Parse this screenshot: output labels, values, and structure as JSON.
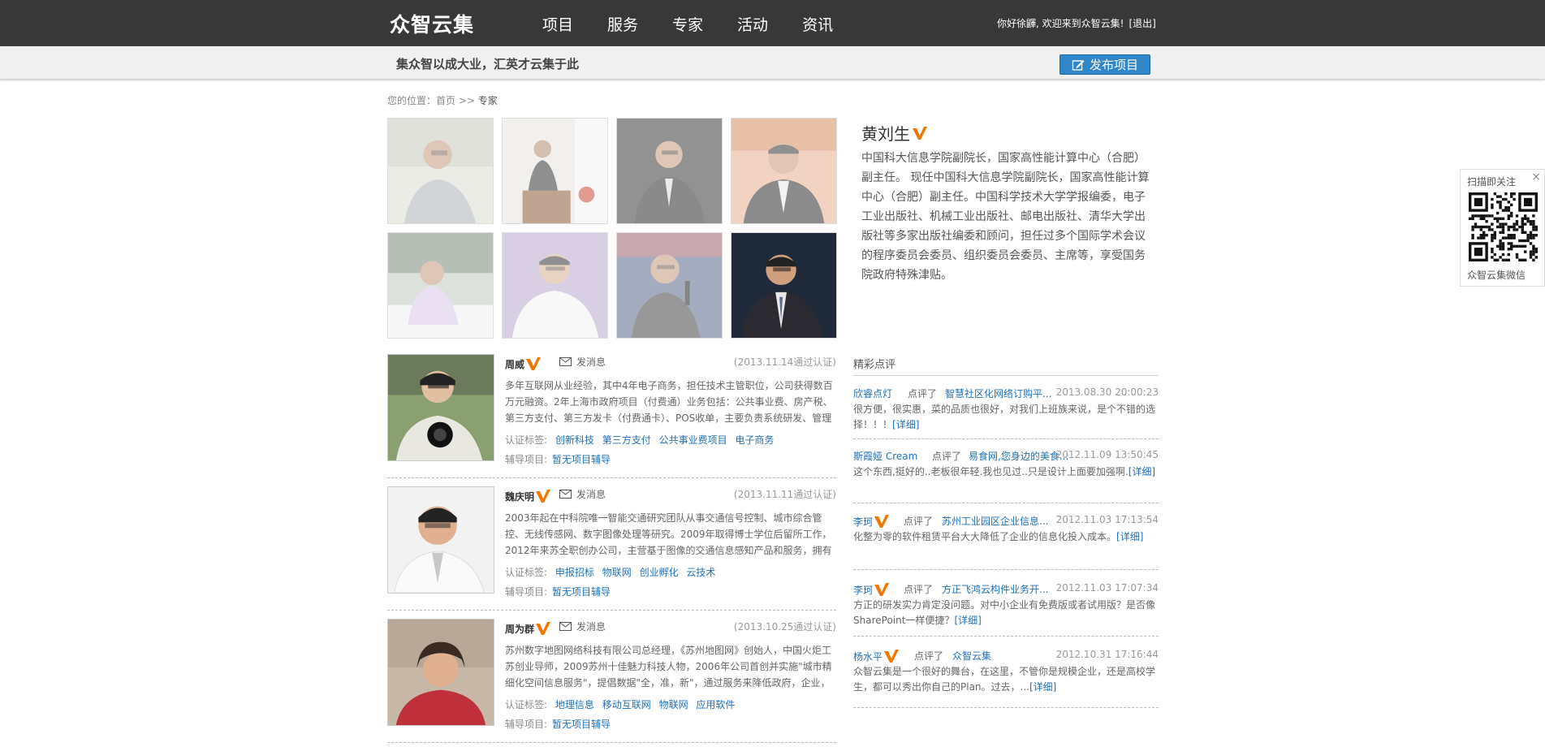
{
  "header": {
    "logo": "众智云集",
    "nav": [
      "项目",
      "服务",
      "专家",
      "活动",
      "资讯"
    ],
    "greeting": "你好徐鼲, 欢迎来到众智云集!",
    "logout": "[退出]"
  },
  "subbar": {
    "slogan": "集众智以成大业，汇英才云集于此",
    "publish_label": "发布项目"
  },
  "breadcrumb": {
    "prefix": "您的位置：",
    "home": "首页",
    "sep": " >> ",
    "current": "专家"
  },
  "featured": {
    "name": "黄刘生",
    "description": "中国科大信息学院副院长，国家高性能计算中心（合肥）副主任。 现任中国科大信息学院副院长，国家高性能计算中心（合肥）副主任。中国科学技术大学学报编委，电子工业出版社、机械工业出版社、邮电出版社、清华大学出版社等多家出版社编委和顾问，担任过多个国际学术会议的程序委员会委员、组织委员会委员、主席等，享受国务院政府特殊津贴。"
  },
  "experts": [
    {
      "name": "周威",
      "msg_label": "发消息",
      "cert": "(2013.11.14通过认证)",
      "bio": "多年互联网从业经验，其中4年电子商务，担任技术主管职位，公司获得数百万元融资。2年上海市政府项目（付费通）业务包括：公共事业费、房产税、第三方支付、第三方发卡（付费通卡）、POS收单，主要负责系统研发、管理等工作。",
      "tags_label": "认证标签:",
      "tags": [
        "创新科技",
        "第三方支付",
        "公共事业费项目",
        "电子商务"
      ],
      "proj_label": "辅导项目:",
      "proj": "暂无项目辅导"
    },
    {
      "name": "魏庆明",
      "msg_label": "发消息",
      "cert": "(2013.11.11通过认证)",
      "bio": "2003年起在中科院唯一智能交通研究团队从事交通信号控制、城市综合管控、无线传感网、数字图像处理等研究。2009年取得博士学位后留所工作，2012年来苏全职创办公司，主营基于图像的交通信息感知产品和服务，拥有多项核心技术。",
      "tags_label": "认证标签:",
      "tags": [
        "申报招标",
        "物联网",
        "创业孵化",
        "云技术"
      ],
      "proj_label": "辅导项目:",
      "proj": "暂无项目辅导"
    },
    {
      "name": "周为群",
      "msg_label": "发消息",
      "cert": "(2013.10.25通过认证)",
      "bio": "苏州数字地图网络科技有限公司总经理，《苏州地图网》创始人，中国火炬工苏创业导师，2009苏州十佳魅力科技人物，2006年公司首创并实施\"城市精细化空间信息服务\"，提倡数据\"全，准，新\"，通过服务来降低政府，企业，公众成本。",
      "tags_label": "认证标签:",
      "tags": [
        "地理信息",
        "移动互联网",
        "物联网",
        "应用软件"
      ],
      "proj_label": "辅导项目:",
      "proj": "暂无项目辅导"
    }
  ],
  "reviews_title": "精彩点评",
  "reviews": [
    {
      "user": "欣睿点灯",
      "verified": false,
      "action": "点评了",
      "project": "智慧社区化网络订购平...",
      "time": "2013.08.30 20:00:23",
      "text": "很方便，很实惠，菜的品质也很好，对我们上班族来说，是个不错的选择！！！",
      "more": "[详细]"
    },
    {
      "user": "斯霞娅 Cream",
      "verified": false,
      "action": "点评了",
      "project": "易食网,您身边的美食...",
      "time": "2012.11.09 13:50:45",
      "text": "这个东西,挺好的..老板很年轻.我也见过..只是设计上面要加强啊.",
      "more": "[详细]"
    },
    {
      "user": "李珂",
      "verified": true,
      "action": "点评了",
      "project": "苏州工业园区企业信息...",
      "time": "2012.11.03 17:13:54",
      "text": "化整为零的软件租赁平台大大降低了企业的信息化投入成本。",
      "more": "[详细]"
    },
    {
      "user": "李珂",
      "verified": true,
      "action": "点评了",
      "project": "方正飞鸿云构件业务开...",
      "time": "2012.11.03 17:07:34",
      "text": "方正的研发实力肯定没问题。对中小企业有免费版或者试用版？是否像SharePoint一样便捷？",
      "more": "[详细]"
    },
    {
      "user": "杨水平",
      "verified": true,
      "action": "点评了",
      "project": "众智云集",
      "time": "2012.10.31 17:16:44",
      "text": "众智云集是一个很好的舞台，在这里，不管你是规模企业，还是高校学生，都可以秀出你自己的Plan。过去，...",
      "more": "[详细]"
    }
  ],
  "qr": {
    "title": "扫描即关注",
    "caption": "众智云集微信",
    "close": "×"
  },
  "colors": {
    "topbar": "#383838",
    "accent_blue": "#2f86c8",
    "link": "#1f70b8",
    "verify_orange": "#f07800"
  }
}
